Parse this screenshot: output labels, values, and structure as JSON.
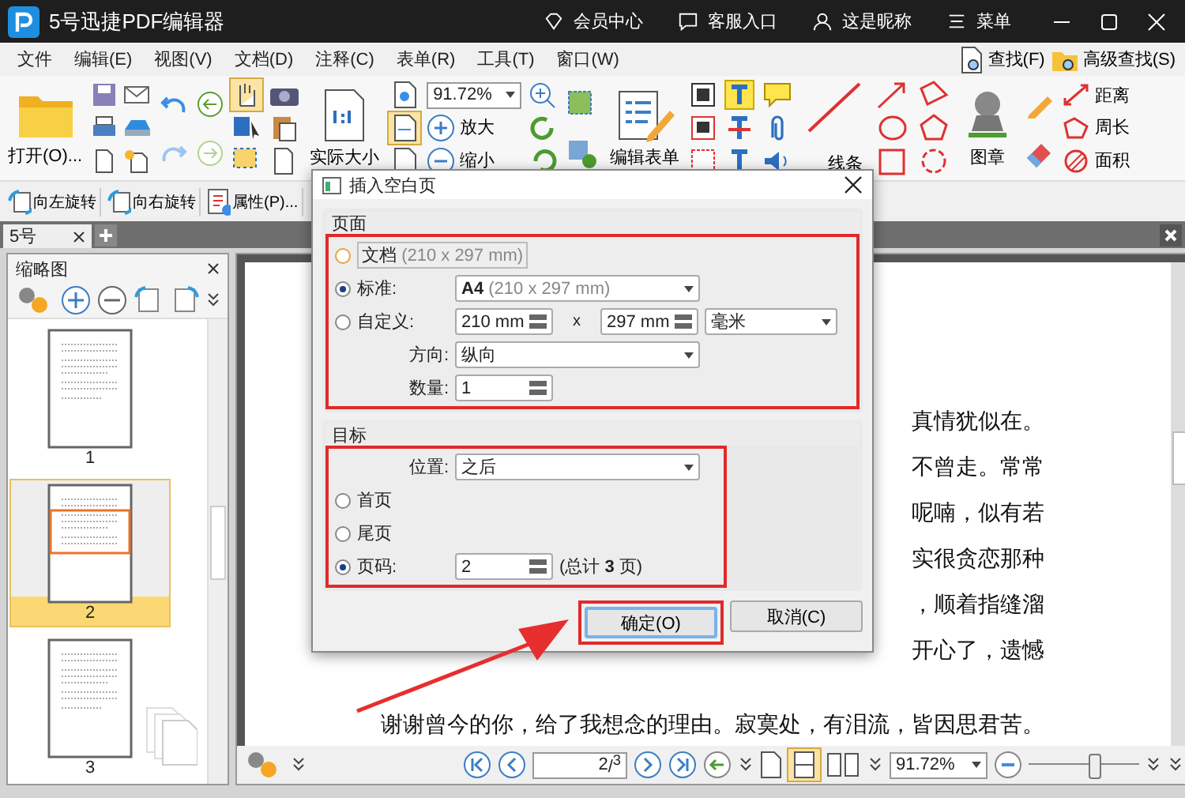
{
  "title_bar": {
    "title": "5号迅捷PDF编辑器",
    "actions": [
      {
        "label": "会员中心",
        "kind": "vip"
      },
      {
        "label": "客服入口",
        "kind": "chat"
      },
      {
        "label": "这是昵称",
        "kind": "user"
      },
      {
        "label": "菜单",
        "kind": "menu"
      }
    ]
  },
  "menu": [
    "文件",
    "编辑(E)",
    "视图(V)",
    "文档(D)",
    "注释(C)",
    "表单(R)",
    "工具(T)",
    "窗口(W)"
  ],
  "search_tools": [
    "查找(F)",
    "高级查找(S)"
  ],
  "ribbon": {
    "open": "打开(O)...",
    "actual_size": "实际大小",
    "zoom_value": "91.72%",
    "zoom_in": "放大",
    "zoom_out": "缩小",
    "edit_form": "编辑表单",
    "lines": "线条",
    "stamp": "图章",
    "measure": [
      "距离",
      "周长",
      "面积"
    ]
  },
  "sub_toolbar": [
    "向左旋转",
    "向右旋转",
    "属性(P)..."
  ],
  "doc_tab": {
    "label": "5号"
  },
  "thumbnails": {
    "title": "缩略图",
    "pages": [
      {
        "label": "1",
        "selected": false
      },
      {
        "label": "2",
        "selected": true
      },
      {
        "label": "3",
        "selected": false
      }
    ]
  },
  "document": {
    "partial_lines": [
      "真情犹似在。",
      "不曾走。常常",
      "呢喃，似有若",
      "实很贪恋那种",
      "，顺着指缝溜",
      "开心了，遗憾"
    ],
    "last_line": "谢谢曾今的你，给了我想念的理由。寂寞处，有泪流，皆因思君苦。"
  },
  "status_bar": {
    "page_current": "2",
    "page_total": "/$^{3}$",
    "zoom_value": "91.72%",
    "zoom": {
      "level": 0.6
    }
  },
  "dialog": {
    "title": "插入空白页",
    "page_group": {
      "title": "页面",
      "doc_option": {
        "label": "文档",
        "hint": "(210 x 297 mm)",
        "selected": false
      },
      "standard_option": {
        "label": "标准:",
        "selected": true,
        "value": "A4",
        "hint": "(210 x 297 mm)"
      },
      "custom_option": {
        "label": "自定义:",
        "selected": false,
        "width": "210 mm",
        "times": "x",
        "height": "297 mm",
        "unit": "毫米"
      },
      "orientation": {
        "label": "方向:",
        "value": "纵向"
      },
      "count": {
        "label": "数量:",
        "value": "1"
      }
    },
    "target_group": {
      "title": "目标",
      "position": {
        "label": "位置:",
        "value": "之后"
      },
      "options": [
        {
          "label": "首页",
          "selected": false
        },
        {
          "label": "尾页",
          "selected": false
        },
        {
          "label": "页码:",
          "selected": true,
          "value": "2",
          "note": "(总计 **3** 页)"
        }
      ]
    },
    "buttons": [
      {
        "label": "确定(O)",
        "kind": "primary"
      },
      {
        "label": "取消(C)",
        "kind": "secondary"
      }
    ]
  }
}
